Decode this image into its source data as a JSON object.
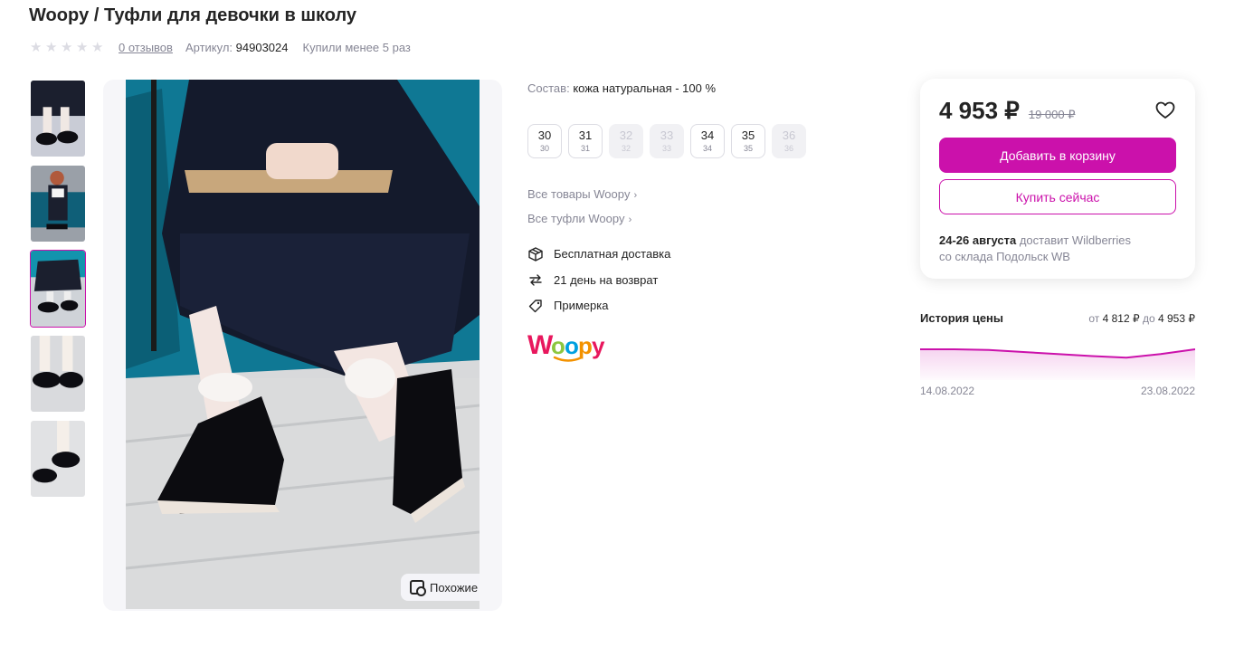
{
  "product": {
    "title": "Woopy / Туфли для девочки в школу",
    "rating_stars": 0,
    "reviews": "0 отзывов",
    "article_label": "Артикул:",
    "article_value": "94903024",
    "bought": "Купили менее 5 раз"
  },
  "gallery": {
    "thumb_count": 5,
    "active_index": 2,
    "similar_label": "Похожие"
  },
  "details": {
    "composition_label": "Состав:",
    "composition_value": "кожа натуральная - 100 %",
    "sizes": [
      {
        "size": "30",
        "ru": "30",
        "available": true
      },
      {
        "size": "31",
        "ru": "31",
        "available": true
      },
      {
        "size": "32",
        "ru": "32",
        "available": false
      },
      {
        "size": "33",
        "ru": "33",
        "available": false
      },
      {
        "size": "34",
        "ru": "34",
        "available": true
      },
      {
        "size": "35",
        "ru": "35",
        "available": true
      },
      {
        "size": "36",
        "ru": "36",
        "available": false
      }
    ],
    "links": [
      "Все товары Woopy",
      "Все туфли Woopy"
    ],
    "features": [
      {
        "icon": "box-icon",
        "label": "Бесплатная доставка"
      },
      {
        "icon": "return-icon",
        "label": "21 день на возврат"
      },
      {
        "icon": "tag-icon",
        "label": "Примерка"
      }
    ],
    "brand_logo_text": "Woopy"
  },
  "buy": {
    "price": "4 953 ₽",
    "old_price": "19 000 ₽",
    "add_to_cart": "Добавить в корзину",
    "buy_now": "Купить сейчас",
    "delivery_date": "24-26 августа",
    "delivery_by": " доставит Wildberries",
    "delivery_from": "со склада Подольск WB"
  },
  "history": {
    "title": "История цены",
    "range_from_label": "от",
    "range_from": "4 812 ₽",
    "range_to_label": "до",
    "range_to": "4 953 ₽",
    "date_start": "14.08.2022",
    "date_end": "23.08.2022",
    "values": [
      4953,
      4953,
      4950,
      4940,
      4930,
      4920,
      4912,
      4930,
      4953
    ],
    "ylim": [
      4812,
      4953
    ]
  },
  "colors": {
    "accent": "#cb11ab",
    "text": "#242424",
    "muted": "#868695"
  }
}
